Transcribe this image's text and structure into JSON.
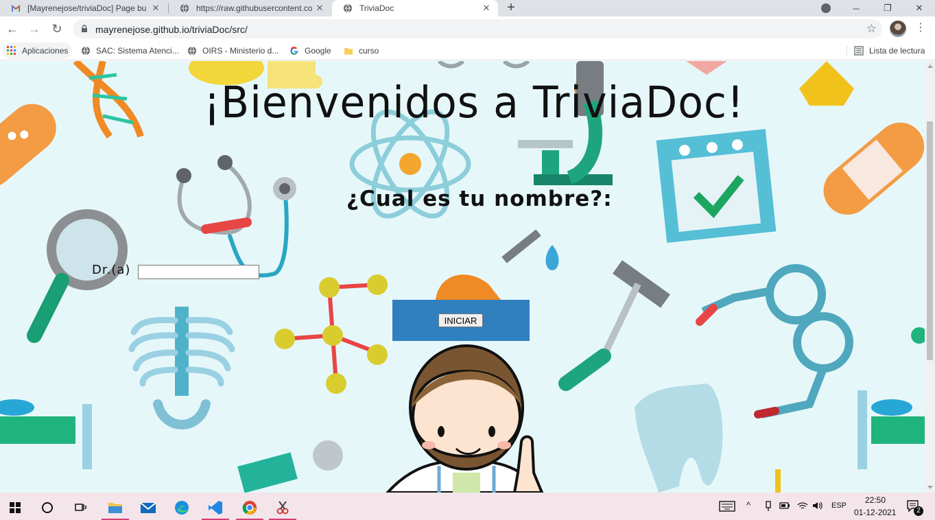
{
  "browser": {
    "tabs": [
      {
        "title": "[Mayrenejose/triviaDoc] Page bu",
        "icon": "gmail-icon"
      },
      {
        "title": "https://raw.githubusercontent.co",
        "icon": "globe-icon"
      },
      {
        "title": "TriviaDoc",
        "icon": "globe-icon",
        "active": true
      }
    ],
    "url": "mayrenejose.github.io/triviaDoc/src/",
    "bookmarks": [
      {
        "label": "Aplicaciones",
        "icon": "apps-grid-icon"
      },
      {
        "label": "SAC: Sistema Atenci...",
        "icon": "globe-icon"
      },
      {
        "label": "OIRS - Ministerio d...",
        "icon": "globe-icon"
      },
      {
        "label": "Google",
        "icon": "google-icon"
      },
      {
        "label": "curso",
        "icon": "folder-icon"
      }
    ],
    "reading_list": "Lista de lectura"
  },
  "page": {
    "welcome_title": "¡Bienvenidos a TriviaDoc!",
    "question": "¿Cual es tu nombre?:",
    "name_label": "Dr.(a)",
    "name_value": "",
    "start_button": "INICIAR",
    "panel_color": "#3080bf",
    "background_color": "#e6f7fa"
  },
  "taskbar": {
    "language": "ESP",
    "time": "22:50",
    "date": "01-12-2021",
    "notifications": "2",
    "accent_color": "#d43f7a"
  }
}
